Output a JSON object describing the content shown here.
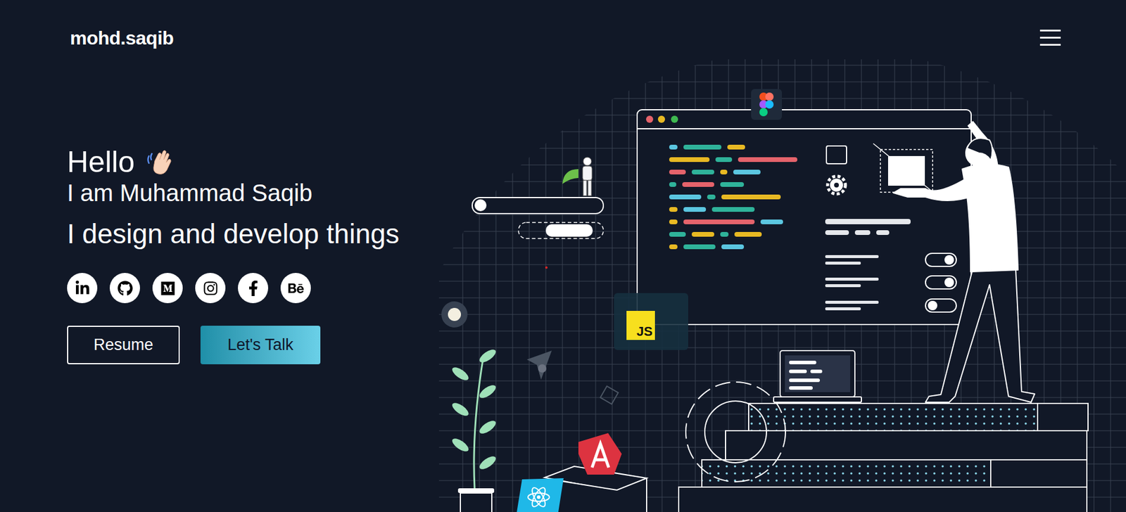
{
  "header": {
    "logo": "mohd.saqib"
  },
  "hero": {
    "greeting": "Hello",
    "intro": "I am Muhammad Saqib",
    "tagline": "I design and develop things"
  },
  "buttons": [
    {
      "label": "Resume",
      "kind": "outline"
    },
    {
      "label": "Let's Talk",
      "kind": "filled"
    }
  ],
  "illustration": {
    "badge": "JS",
    "toggles": [
      {
        "on": true
      },
      {
        "on": true
      },
      {
        "on": false
      }
    ]
  }
}
